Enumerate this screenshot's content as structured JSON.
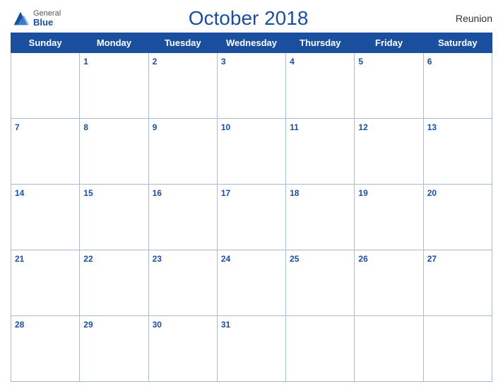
{
  "header": {
    "logo_general": "General",
    "logo_blue": "Blue",
    "month_title": "October 2018",
    "region": "Reunion"
  },
  "weekdays": [
    "Sunday",
    "Monday",
    "Tuesday",
    "Wednesday",
    "Thursday",
    "Friday",
    "Saturday"
  ],
  "weeks": [
    [
      null,
      1,
      2,
      3,
      4,
      5,
      6
    ],
    [
      7,
      8,
      9,
      10,
      11,
      12,
      13
    ],
    [
      14,
      15,
      16,
      17,
      18,
      19,
      20
    ],
    [
      21,
      22,
      23,
      24,
      25,
      26,
      27
    ],
    [
      28,
      29,
      30,
      31,
      null,
      null,
      null
    ]
  ]
}
